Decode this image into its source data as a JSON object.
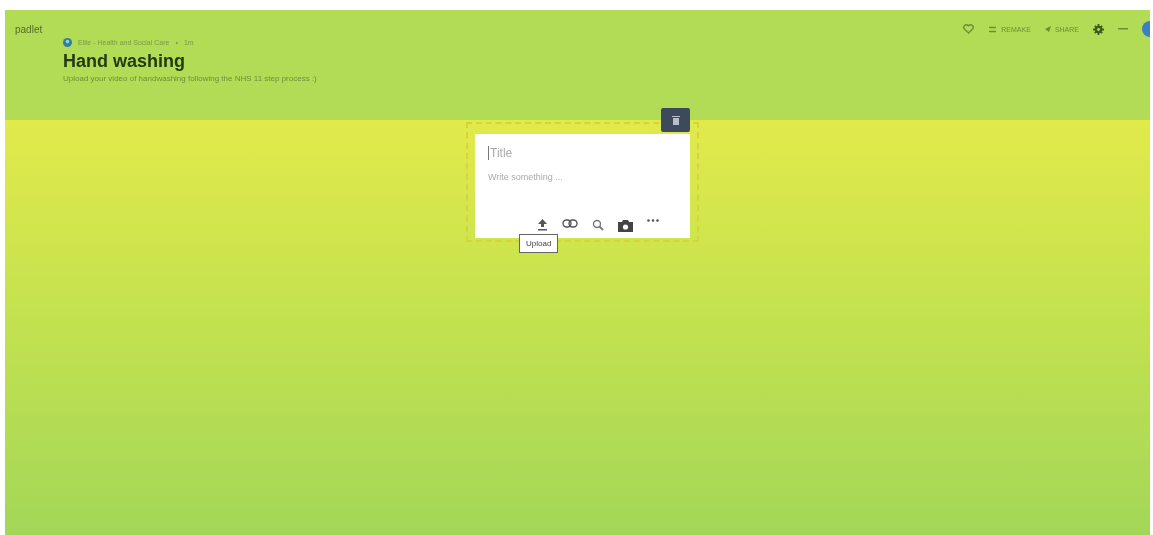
{
  "brand": "padlet",
  "header": {
    "author": "Ellie - Health and Social Care",
    "separator": "•",
    "time": "1m",
    "title": "Hand washing",
    "description": "Upload your video of handwashing following the NHS 11 step process :)"
  },
  "actions": [
    {
      "kind": "heart"
    },
    {
      "kind": "remake",
      "label": "REMAKE"
    },
    {
      "kind": "share",
      "label": "SHARE"
    },
    {
      "kind": "gear"
    },
    {
      "kind": "minimize"
    },
    {
      "kind": "avatar"
    }
  ],
  "post": {
    "title_placeholder": "Title",
    "body_placeholder": "Write something ...",
    "tools": [
      {
        "kind": "upload"
      },
      {
        "kind": "link"
      },
      {
        "kind": "search"
      },
      {
        "kind": "camera"
      },
      {
        "kind": "more"
      }
    ],
    "tooltip": "Upload"
  }
}
